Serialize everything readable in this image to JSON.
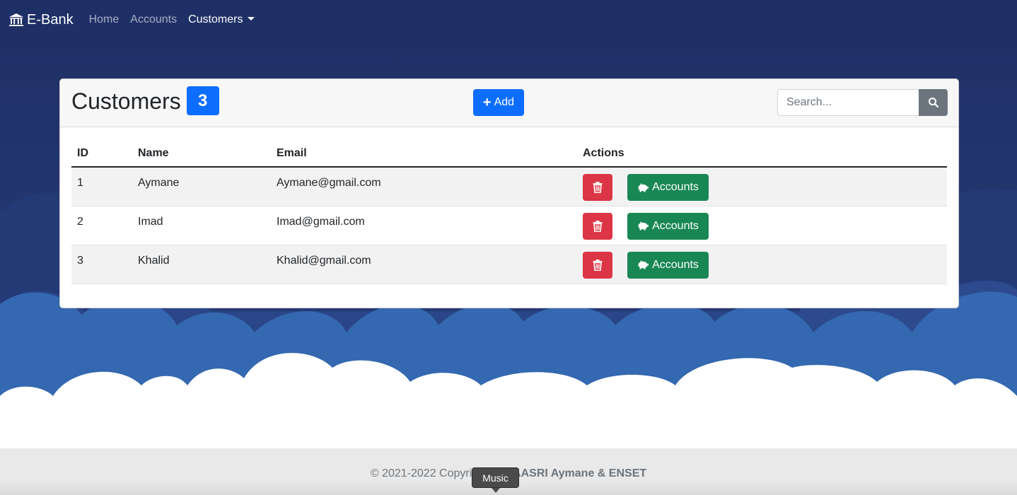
{
  "navbar": {
    "brand": "E-Bank",
    "brand_icon": "bank-icon",
    "links": [
      {
        "label": "Home"
      },
      {
        "label": "Accounts"
      },
      {
        "label": "Customers"
      }
    ]
  },
  "card": {
    "title": "Customers",
    "count": "3",
    "add_label": "Add",
    "search_placeholder": "Search..."
  },
  "table": {
    "headers": [
      "ID",
      "Name",
      "Email",
      "Actions"
    ],
    "rows": [
      {
        "id": "1",
        "name": "Aymane",
        "email": "Aymane@gmail.com",
        "accounts_label": "Accounts"
      },
      {
        "id": "2",
        "name": "Imad",
        "email": "Imad@gmail.com",
        "accounts_label": "Accounts"
      },
      {
        "id": "3",
        "name": "Khalid",
        "email": "Khalid@gmail.com",
        "accounts_label": "Accounts"
      }
    ]
  },
  "footer": {
    "text_prefix": "© 2021-2022 Copyri",
    "text_bold": "LAASRI Aymane & ENSET"
  },
  "tooltip": {
    "label": "Music"
  },
  "colors": {
    "primary": "#0d6efd",
    "danger": "#dc3545",
    "success": "#198754",
    "secondary": "#6c757d",
    "navbar_bg": "#1e2f65"
  }
}
